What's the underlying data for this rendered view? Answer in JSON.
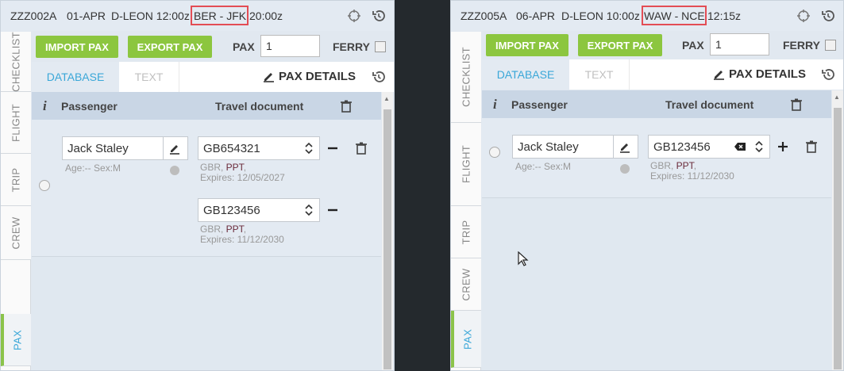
{
  "left": {
    "header": {
      "flight_id": "ZZZ002A",
      "date": "01-APR",
      "departure": "D-LEON 12:00z",
      "route": "BER - JFK",
      "arrival_time": "20:00z"
    },
    "side_tabs": [
      "CHECKLIST",
      "FLIGHT",
      "TRIP",
      "CREW",
      "PAX"
    ],
    "toolbar": {
      "import_label": "IMPORT PAX",
      "export_label": "EXPORT PAX",
      "pax_label": "PAX",
      "pax_value": "1",
      "ferry_label": "FERRY"
    },
    "tabs": {
      "database": "DATABASE",
      "text": "TEXT",
      "pax_details": "PAX DETAILS"
    },
    "table": {
      "info_glyph": "i",
      "col_passenger": "Passenger",
      "col_travel_document": "Travel document"
    },
    "passenger": {
      "name": "Jack Staley",
      "meta": "Age:-- Sex:M",
      "documents": [
        {
          "number": "GB654321",
          "country": "GBR, ",
          "type": "PPT",
          "type_suffix": ",",
          "expires": "Expires: 12/05/2027"
        },
        {
          "number": "GB123456",
          "country": "GBR, ",
          "type": "PPT",
          "type_suffix": ",",
          "expires": "Expires: 11/12/2030"
        }
      ]
    }
  },
  "right": {
    "header": {
      "flight_id": "ZZZ005A",
      "date": "06-APR",
      "departure": "D-LEON 10:00z",
      "route": "WAW - NCE",
      "arrival_time": "12:15z"
    },
    "side_tabs": [
      "CHECKLIST",
      "FLIGHT",
      "TRIP",
      "CREW",
      "PAX"
    ],
    "toolbar": {
      "import_label": "IMPORT PAX",
      "export_label": "EXPORT PAX",
      "pax_label": "PAX",
      "pax_value": "1",
      "ferry_label": "FERRY"
    },
    "tabs": {
      "database": "DATABASE",
      "text": "TEXT",
      "pax_details": "PAX DETAILS"
    },
    "table": {
      "info_glyph": "i",
      "col_passenger": "Passenger",
      "col_travel_document": "Travel document"
    },
    "passenger": {
      "name": "Jack Staley",
      "meta": "Age:-- Sex:M",
      "documents": [
        {
          "number": "GB123456",
          "country": "GBR, ",
          "type": "PPT",
          "type_suffix": ",",
          "expires": "Expires: 11/12/2030"
        }
      ]
    }
  },
  "colors": {
    "accent_green": "#8cc63f",
    "active_blue": "#3aa7d8",
    "highlight_red": "#e34d55"
  }
}
